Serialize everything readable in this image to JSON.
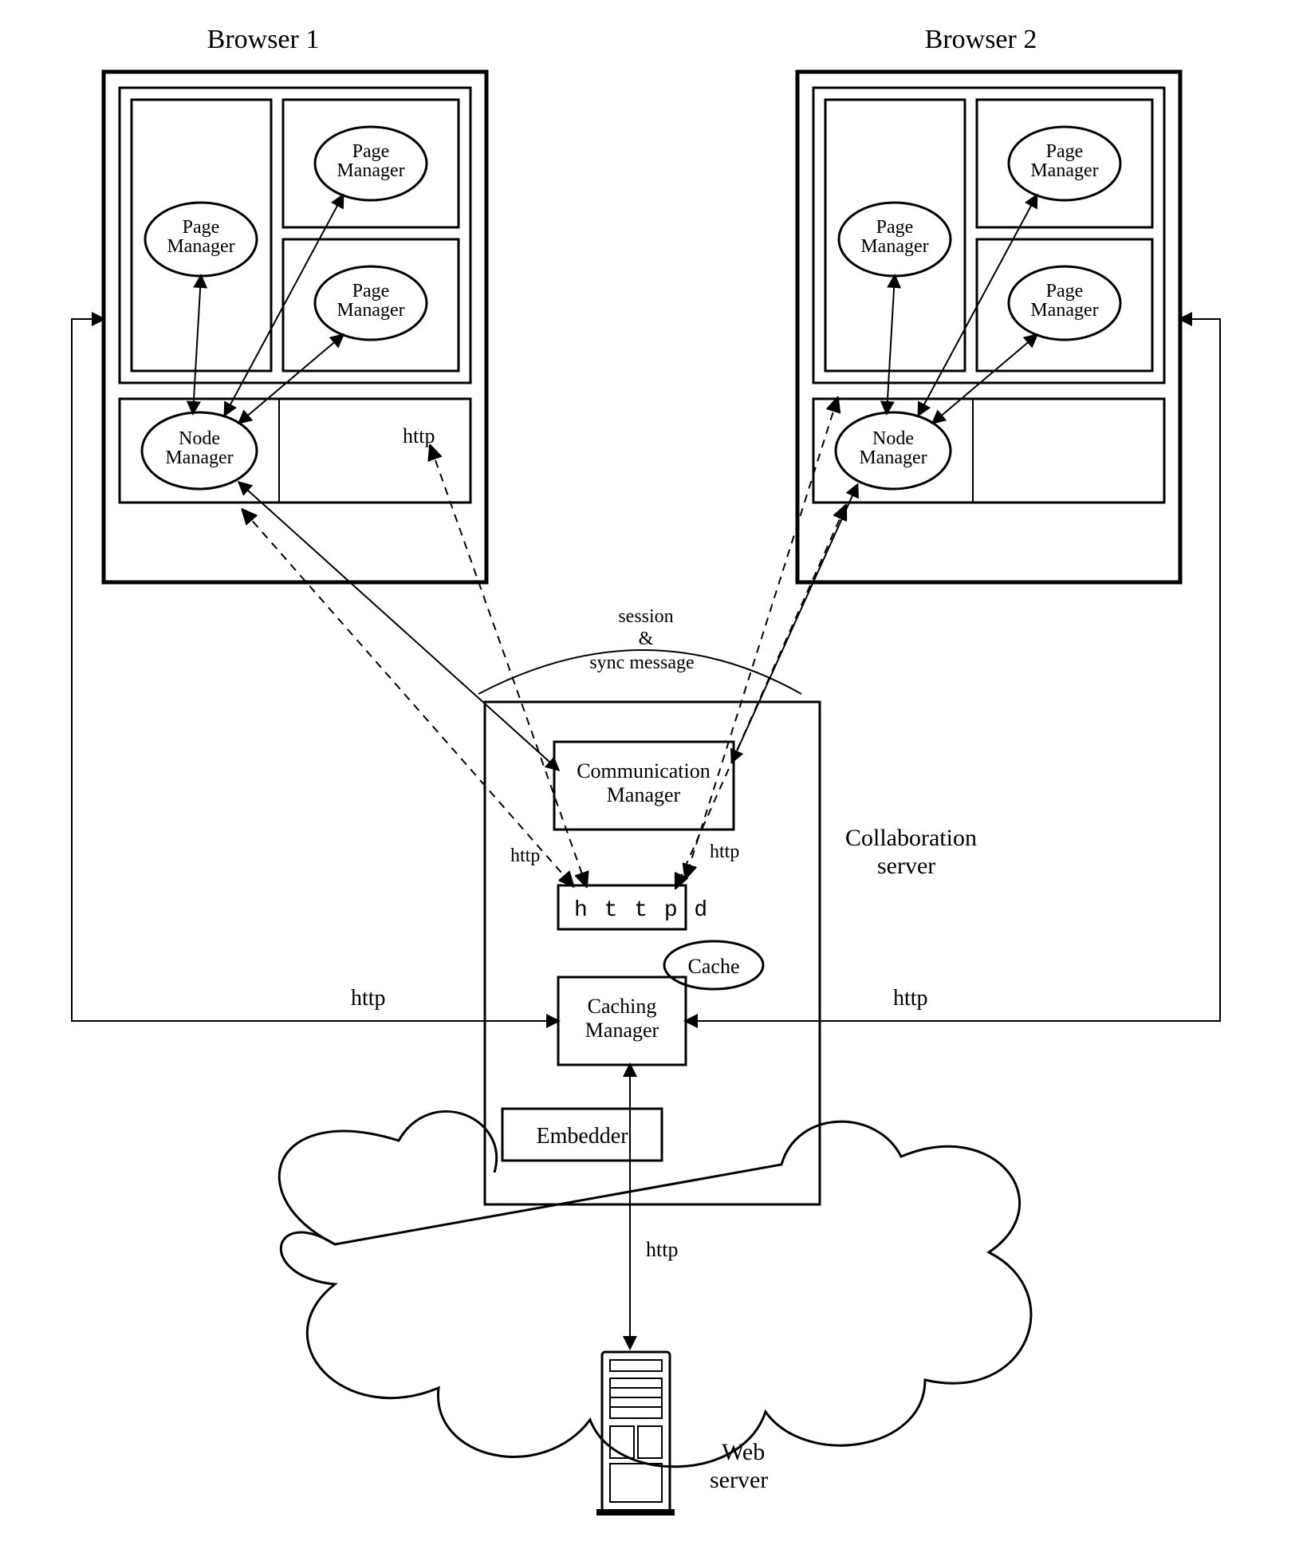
{
  "browsers": [
    {
      "title": "Browser  1"
    },
    {
      "title": "Browser  2"
    }
  ],
  "nodes": {
    "pageManager": "Page\nManager",
    "nodeManager": "Node\nManager",
    "commManager": "Communication\nManager",
    "httpd": "h t t p d",
    "cache": "Cache",
    "cachingManager": "Caching\nManager",
    "embedder": "Embedder"
  },
  "labels": {
    "httpInner": "http",
    "httpLeft": "http",
    "httpRight": "http",
    "httpOuterLeft": "http",
    "httpOuterRight": "http",
    "httpBottom": "http",
    "session": "session",
    "amp": "&",
    "syncMsg": "sync message",
    "collabServer": "Collaboration\nserver",
    "webServer": "Web\nserver"
  }
}
